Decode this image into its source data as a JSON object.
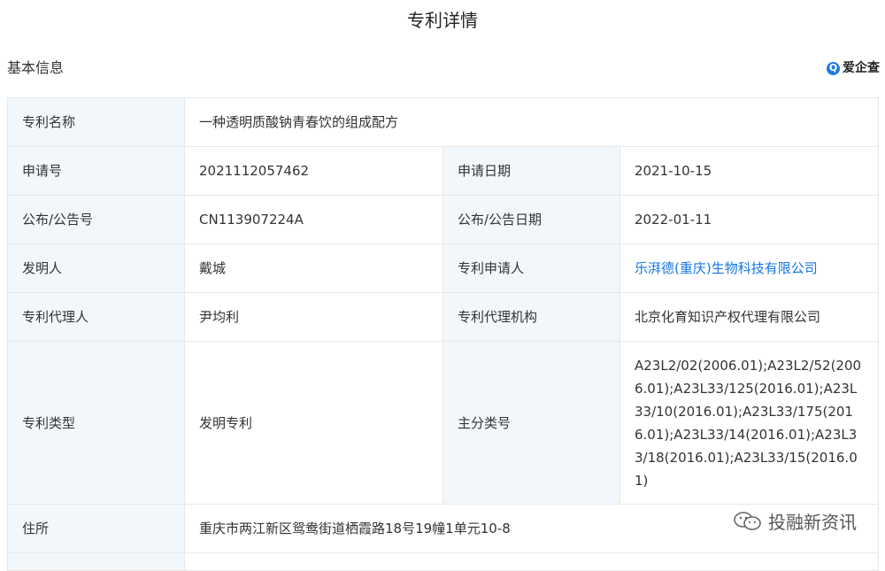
{
  "page_title": "专利详情",
  "section_title": "基本信息",
  "brand": {
    "icon": "Q",
    "name": "爱企查",
    "accent": "#1f7ae0"
  },
  "link_color": "#1677e6",
  "label_bg": "#f2f7fc",
  "rows": {
    "name": {
      "label": "专利名称",
      "value": "一种透明质酸钠青春饮的组成配方"
    },
    "app_no": {
      "label": "申请号",
      "value": "2021112057462"
    },
    "app_date": {
      "label": "申请日期",
      "value": "2021-10-15"
    },
    "pub_no": {
      "label": "公布/公告号",
      "value": "CN113907224A"
    },
    "pub_date": {
      "label": "公布/公告日期",
      "value": "2022-01-11"
    },
    "inventor": {
      "label": "发明人",
      "value": "戴城"
    },
    "applicant": {
      "label": "专利申请人",
      "value": "乐湃德(重庆)生物科技有限公司"
    },
    "agent": {
      "label": "专利代理人",
      "value": "尹均利"
    },
    "agency": {
      "label": "专利代理机构",
      "value": "北京化育知识产权代理有限公司"
    },
    "type": {
      "label": "专利类型",
      "value": "发明专利"
    },
    "ipc": {
      "label": "主分类号",
      "value": "A23L2/02(2006.01);A23L2/52(2006.01);A23L33/125(2016.01);A23L33/10(2016.01);A23L33/175(2016.01);A23L33/14(2016.01);A23L33/18(2016.01);A23L33/15(2016.01)"
    },
    "address": {
      "label": "住所",
      "value": "重庆市两江新区鸳鸯街道栖霞路18号19幢1单元10-8"
    }
  },
  "watermark": {
    "icon": "wechat-icon",
    "text": "投融新资讯"
  }
}
